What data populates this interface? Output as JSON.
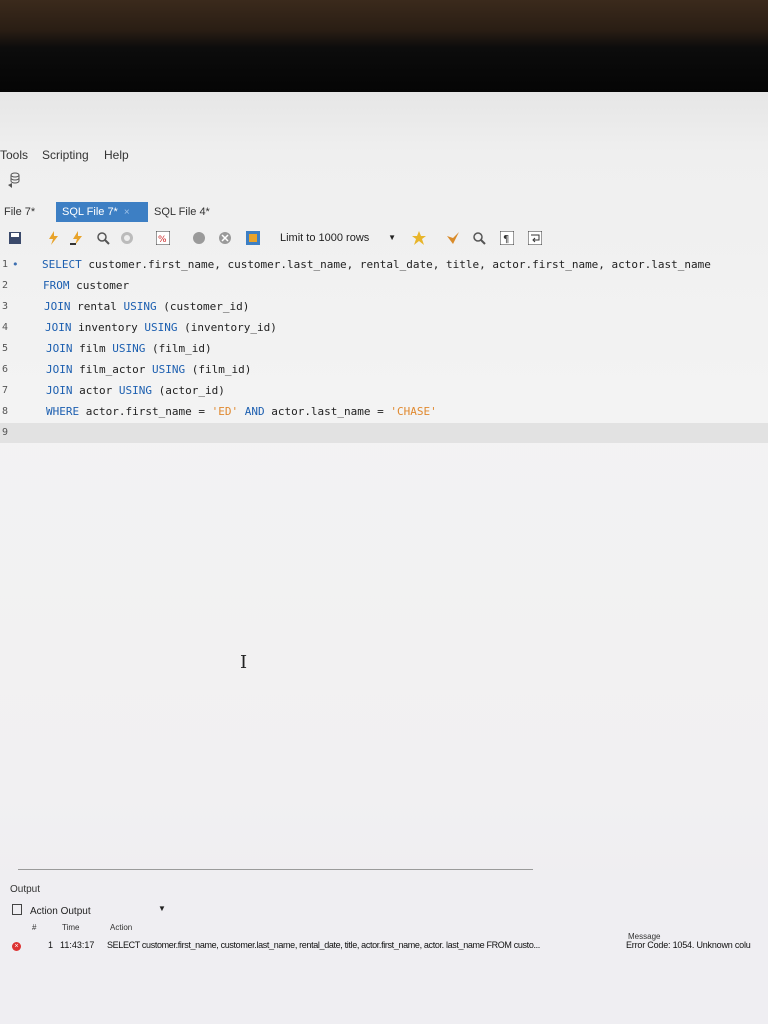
{
  "menu": [
    "Tools",
    "Scripting",
    "Help"
  ],
  "tabs": [
    {
      "label": "File 7*",
      "active": false
    },
    {
      "label": "SQL File 7*",
      "active": true,
      "close": "×"
    },
    {
      "label": "SQL File 4*",
      "active": false
    }
  ],
  "toolbar": {
    "limit_label": "Limit to 1000 rows",
    "limit_arrow": "▼"
  },
  "editor": {
    "line_numbers": [
      "1",
      "2",
      "3",
      "4",
      "5",
      "6",
      "7",
      "8",
      "9"
    ],
    "line_marker": "•",
    "lines": [
      [
        {
          "k": "kw",
          "t": "SELECT"
        },
        {
          "k": "",
          "t": " customer.first_name, customer.last_name, rental_date, title, actor.first_name, actor.last_name"
        }
      ],
      [
        {
          "k": "kw",
          "t": "FROM"
        },
        {
          "k": "",
          "t": " customer"
        }
      ],
      [
        {
          "k": "kw",
          "t": "JOIN"
        },
        {
          "k": "",
          "t": " rental "
        },
        {
          "k": "kw",
          "t": "USING"
        },
        {
          "k": "",
          "t": " (customer_id)"
        }
      ],
      [
        {
          "k": "kw",
          "t": "JOIN"
        },
        {
          "k": "",
          "t": " inventory "
        },
        {
          "k": "kw",
          "t": "USING"
        },
        {
          "k": "",
          "t": " (inventory_id)"
        }
      ],
      [
        {
          "k": "kw",
          "t": "JOIN"
        },
        {
          "k": "",
          "t": " film "
        },
        {
          "k": "kw",
          "t": "USING"
        },
        {
          "k": "",
          "t": " (film_id)"
        }
      ],
      [
        {
          "k": "kw",
          "t": "JOIN"
        },
        {
          "k": "",
          "t": " film_actor "
        },
        {
          "k": "kw",
          "t": "USING"
        },
        {
          "k": "",
          "t": " (film_id)"
        }
      ],
      [
        {
          "k": "kw",
          "t": "JOIN"
        },
        {
          "k": "",
          "t": " actor "
        },
        {
          "k": "kw",
          "t": "USING"
        },
        {
          "k": "",
          "t": " (actor_id)"
        }
      ],
      [
        {
          "k": "kw",
          "t": "WHERE"
        },
        {
          "k": "",
          "t": " actor.first_name = "
        },
        {
          "k": "str",
          "t": "'ED'"
        },
        {
          "k": "",
          "t": " "
        },
        {
          "k": "kw",
          "t": "AND"
        },
        {
          "k": "",
          "t": " actor.last_name = "
        },
        {
          "k": "str",
          "t": "'CHASE'"
        }
      ],
      []
    ]
  },
  "output": {
    "label": "Output",
    "selector": "Action Output",
    "selector_arrow": "▼",
    "columns": {
      "num": "#",
      "time": "Time",
      "action": "Action",
      "message": "Message"
    },
    "rows": [
      {
        "num": "1",
        "time": "11:43:17",
        "action": "SELECT customer.first_name, customer.last_name, rental_date, title, actor.first_name, actor. last_name FROM custo...",
        "message": "Error Code: 1054. Unknown colu",
        "status_icon": "error-icon"
      }
    ]
  },
  "colors": {
    "keyword": "#1c5fb0",
    "string": "#e0892f",
    "active_tab": "#3d7fc4",
    "error": "#dd3333"
  }
}
